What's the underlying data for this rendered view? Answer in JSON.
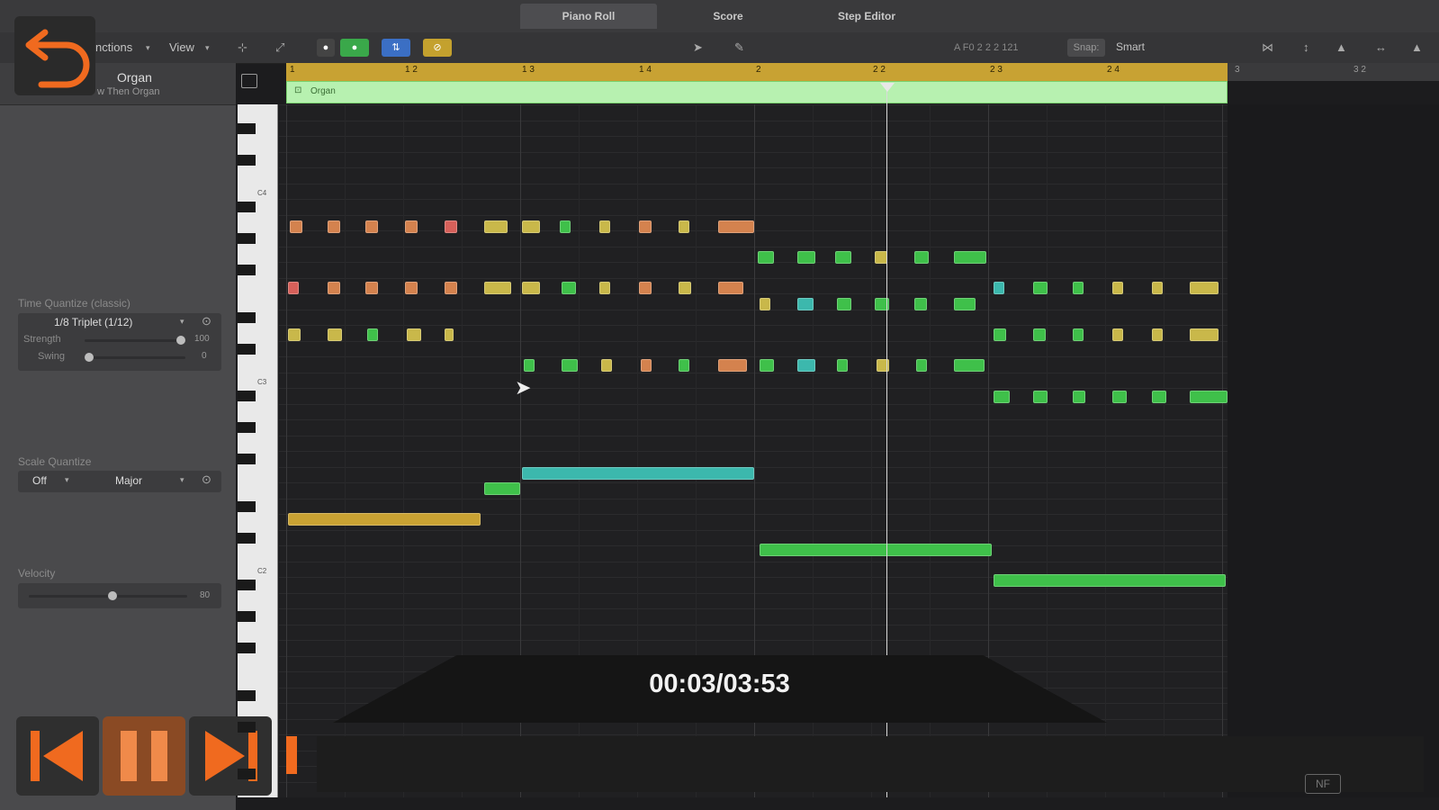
{
  "tabs": [
    {
      "label": "Piano Roll",
      "active": true
    },
    {
      "label": "Score",
      "active": false
    },
    {
      "label": "Step Editor",
      "active": false
    }
  ],
  "toolbar": {
    "functions_label": "nctions",
    "view_label": "View",
    "position_readout": "A F0   2 2 2 121",
    "snap_label": "Snap:",
    "snap_value": "Smart"
  },
  "region": {
    "title": "Organ",
    "subtitle": "w Then Organ",
    "bar_label": "Organ"
  },
  "ruler": {
    "marks": [
      "1",
      "1 2",
      "1 3",
      "1 4",
      "2",
      "2 2",
      "2 3",
      "2 4",
      "3",
      "3 2"
    ]
  },
  "keyboard": {
    "c_labels": [
      "C4",
      "C3",
      "C2"
    ]
  },
  "inspector": {
    "time_quantize_label": "Time Quantize (classic)",
    "time_quantize_value": "1/8 Triplet (1/12)",
    "strength_label": "Strength",
    "strength_value": "100",
    "strength_fraction": 1.0,
    "swing_label": "Swing",
    "swing_value": "0",
    "swing_fraction": 0.0,
    "scale_quantize_label": "Scale Quantize",
    "scale_off_value": "Off",
    "scale_mode_value": "Major",
    "velocity_label": "Velocity",
    "velocity_value": "80",
    "velocity_fraction": 0.62
  },
  "player": {
    "time": "00:03/03:53"
  },
  "colors": {
    "orange": "#d4824e",
    "red": "#d6605a",
    "yellow": "#c9b84a",
    "green": "#3fc04a",
    "teal": "#3cb8ad",
    "gold": "#c9a233",
    "accent": "#f06a1f"
  },
  "icons": {
    "back": "undo-arrow-icon",
    "prev": "skip-back-icon",
    "pause": "pause-icon",
    "next": "skip-forward-icon",
    "logo": "nf-logo-icon"
  }
}
